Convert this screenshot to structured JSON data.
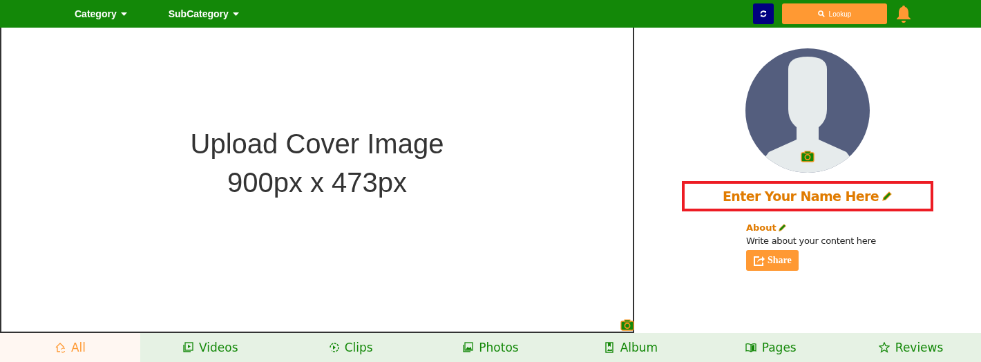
{
  "navbar": {
    "menus": [
      {
        "label": "Category"
      },
      {
        "label": "SubCategory"
      }
    ],
    "lookup_button": "Lookup"
  },
  "cover": {
    "title": "Upload Cover Image",
    "size": "900px x 473px"
  },
  "profile": {
    "name": "Enter Your Name Here",
    "name_highlighted": true,
    "about_label": "About",
    "about_text": "Write about your content here",
    "share_button": "Share"
  },
  "tabs": [
    {
      "label": "All",
      "selected": true
    },
    {
      "label": "Videos",
      "selected": false
    },
    {
      "label": "Clips",
      "selected": false
    },
    {
      "label": "Photos",
      "selected": false
    },
    {
      "label": "Album",
      "selected": false
    },
    {
      "label": "Pages",
      "selected": false
    },
    {
      "label": "Reviews",
      "selected": false
    }
  ]
}
